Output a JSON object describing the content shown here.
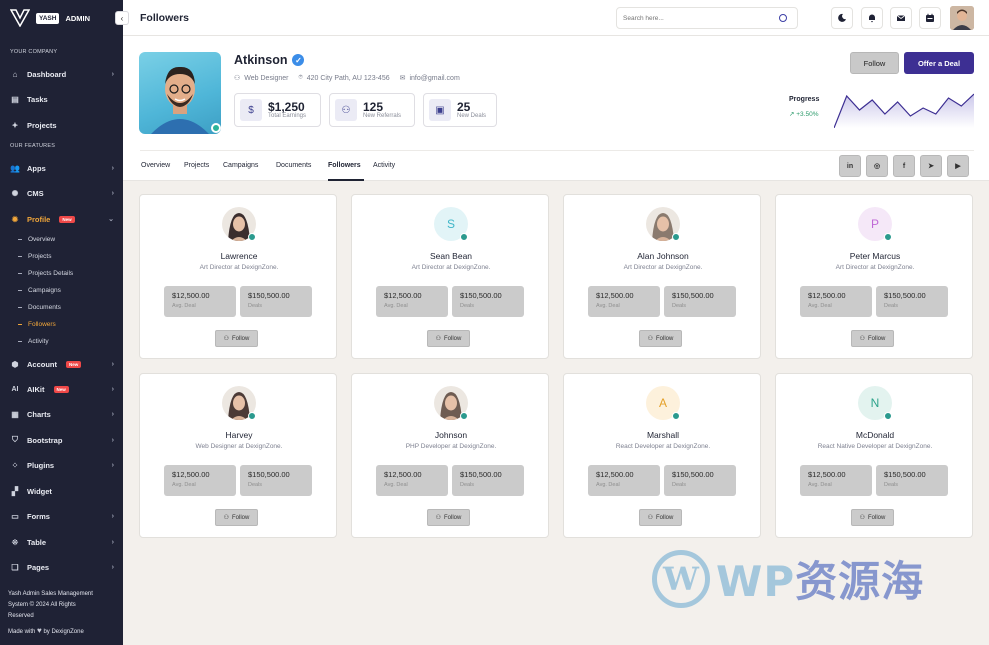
{
  "sidebar": {
    "logo_badge": "YASH",
    "logo_text": "ADMIN",
    "section_company": "YOUR COMPANY",
    "section_features": "OUR FEATURES",
    "items": [
      {
        "label": "Dashboard",
        "icon": "home-icon"
      },
      {
        "label": "Tasks",
        "icon": "inbox-icon"
      },
      {
        "label": "Projects",
        "icon": "pin-icon"
      },
      {
        "label": "Apps",
        "icon": "users-icon"
      },
      {
        "label": "CMS",
        "icon": "sun-icon"
      },
      {
        "label": "Profile",
        "icon": "gear-icon",
        "badge": "New"
      },
      {
        "label": "Account",
        "icon": "shield-icon",
        "badge": "New"
      },
      {
        "label": "AIKit",
        "icon": "ai-icon",
        "badge": "New"
      },
      {
        "label": "Charts",
        "icon": "chart-icon"
      },
      {
        "label": "Bootstrap",
        "icon": "shield-heart-icon"
      },
      {
        "label": "Plugins",
        "icon": "plugin-icon"
      },
      {
        "label": "Widget",
        "icon": "grid-icon"
      },
      {
        "label": "Forms",
        "icon": "form-icon"
      },
      {
        "label": "Table",
        "icon": "table-icon"
      },
      {
        "label": "Pages",
        "icon": "pages-icon"
      }
    ],
    "profile_sub": [
      "Overview",
      "Projects",
      "Projects Details",
      "Campaigns",
      "Documents",
      "Followers",
      "Activity"
    ],
    "footer_line1": "Yash Admin Sales Management",
    "footer_line2": "System © 2024 All Rights",
    "footer_line3": "Reserved",
    "footer_made": "Made with",
    "footer_by": "by DexignZone"
  },
  "topbar": {
    "title": "Followers",
    "search_placeholder": "Search here..."
  },
  "profile": {
    "name": "Atkinson",
    "role": "Web Designer",
    "address": "420 City Path, AU 123-456",
    "email": "info@gmail.com",
    "stats": [
      {
        "value": "$1,250",
        "label": "Total Earnings",
        "icon": "dollar-icon"
      },
      {
        "value": "125",
        "label": "New Referrals",
        "icon": "users-icon"
      },
      {
        "value": "25",
        "label": "New Deals",
        "icon": "briefcase-icon"
      }
    ],
    "follow_label": "Follow",
    "deal_label": "Offer a Deal",
    "progress_label": "Progress",
    "progress_value": "+3.50%",
    "progress_series": [
      40,
      8,
      22,
      12,
      26,
      14,
      28,
      20,
      26,
      10,
      18,
      6
    ],
    "tabs": [
      "Overview",
      "Projects",
      "Campaigns",
      "Documents",
      "Followers",
      "Activity"
    ],
    "social": [
      "in",
      "ig",
      "f",
      "tg",
      "yt"
    ]
  },
  "followers": [
    {
      "name": "Lawrence",
      "role": "Art Director at DexignZone.",
      "initial": "",
      "deal": "$12,500.00",
      "deal_label": "Avg. Deal",
      "deals": "$150,500.00",
      "deals_label": "Deals",
      "follow": "Follow",
      "avatar_color": "#3b2e2e"
    },
    {
      "name": "Sean Bean",
      "role": "Art Director at DexignZone.",
      "initial": "S",
      "deal": "$12,500.00",
      "deal_label": "Avg. Deal",
      "deals": "$150,500.00",
      "deals_label": "Deals",
      "follow": "Follow",
      "avatar_color": "#e2f4f7",
      "initial_color": "#3fb6c8"
    },
    {
      "name": "Alan Johnson",
      "role": "Art Director at DexignZone.",
      "initial": "",
      "deal": "$12,500.00",
      "deal_label": "Avg. Deal",
      "deals": "$150,500.00",
      "deals_label": "Deals",
      "follow": "Follow",
      "avatar_color": "#8a7a6e"
    },
    {
      "name": "Peter Marcus",
      "role": "Art Director at DexignZone.",
      "initial": "P",
      "deal": "$12,500.00",
      "deal_label": "Avg. Deal",
      "deals": "$150,500.00",
      "deals_label": "Deals",
      "follow": "Follow",
      "avatar_color": "#f5e8f8",
      "initial_color": "#c068d6"
    },
    {
      "name": "Harvey",
      "role": "Web Designer at DexignZone.",
      "initial": "",
      "deal": "$12,500.00",
      "deal_label": "Avg. Deal",
      "deals": "$150,500.00",
      "deals_label": "Deals",
      "follow": "Follow",
      "avatar_color": "#4b3a36"
    },
    {
      "name": "Johnson",
      "role": "PHP Developer at DexignZone.",
      "initial": "",
      "deal": "$12,500.00",
      "deal_label": "Avg. Deal",
      "deals": "$150,500.00",
      "deals_label": "Deals",
      "follow": "Follow",
      "avatar_color": "#6e5c52"
    },
    {
      "name": "Marshall",
      "role": "React Developer at DexignZone.",
      "initial": "A",
      "deal": "$12,500.00",
      "deal_label": "Avg. Deal",
      "deals": "$150,500.00",
      "deals_label": "Deals",
      "follow": "Follow",
      "avatar_color": "#fdf1dc",
      "initial_color": "#e4a028"
    },
    {
      "name": "McDonald",
      "role": "React Native Developer at DexignZone.",
      "initial": "N",
      "deal": "$12,500.00",
      "deal_label": "Avg. Deal",
      "deals": "$150,500.00",
      "deals_label": "Deals",
      "follow": "Follow",
      "avatar_color": "#e3f3ef",
      "initial_color": "#2ea38b"
    }
  ],
  "watermark": {
    "logo": "W",
    "latin": "WP",
    "cjk": "资源海"
  }
}
